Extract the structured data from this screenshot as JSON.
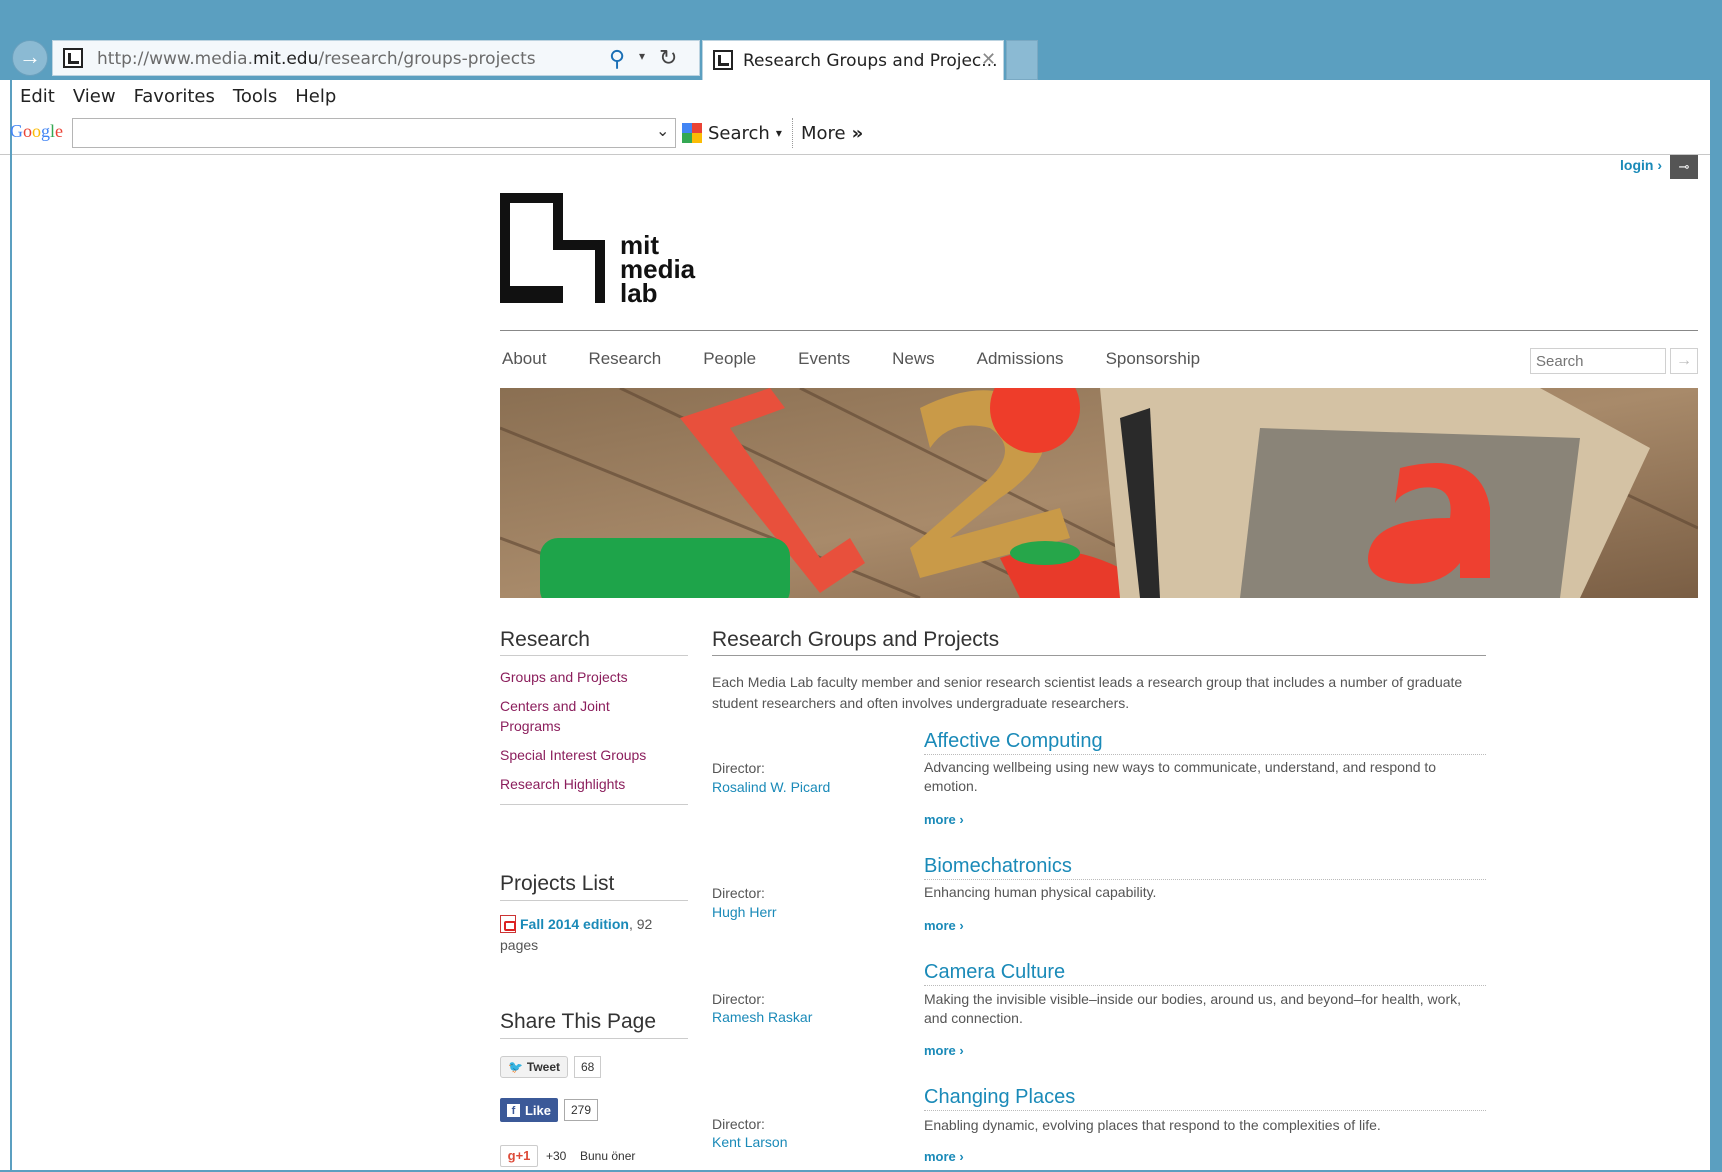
{
  "browser": {
    "url_prefix": "http://www.media.",
    "url_domain": "mit.edu",
    "url_path": "/research/groups-projects",
    "tab_title": "Research Groups and Projec...",
    "menu": [
      "Edit",
      "View",
      "Favorites",
      "Tools",
      "Help"
    ],
    "google_logo": "Google",
    "toolbar_search": "Search",
    "toolbar_more": "More"
  },
  "site": {
    "login": "login ›",
    "logo_lines": [
      "mit",
      "media",
      "lab"
    ],
    "nav": [
      "About",
      "Research",
      "People",
      "Events",
      "News",
      "Admissions",
      "Sponsorship"
    ],
    "search_placeholder": "Search"
  },
  "sidebar": {
    "research_title": "Research",
    "research_links": [
      "Groups and Projects",
      "Centers and Joint Programs",
      "Special Interest Groups",
      "Research Highlights"
    ],
    "projects_title": "Projects List",
    "projects_link": "Fall 2014 edition",
    "projects_suffix": ", 92 pages",
    "share_title": "Share This Page",
    "tweet_label": "Tweet",
    "tweet_count": "68",
    "like_label": "Like",
    "like_count": "279",
    "gplus_label": "+1",
    "gplus_count": "+30",
    "gplus_text": "Bunu öner"
  },
  "main": {
    "title": "Research Groups and Projects",
    "intro": "Each Media Lab faculty member and senior research scientist leads a research group that includes a number of graduate student researchers and often involves undergraduate researchers.",
    "director_label": "Director:",
    "more_label": "more ›",
    "groups": [
      {
        "name": "Affective Computing",
        "director": "Rosalind W. Picard",
        "desc": "Advancing wellbeing using new ways to communicate, understand, and respond to emotion."
      },
      {
        "name": "Biomechatronics",
        "director": "Hugh Herr",
        "desc": "Enhancing human physical capability."
      },
      {
        "name": "Camera Culture",
        "director": "Ramesh Raskar",
        "desc": "Making the invisible visible–inside our bodies, around us, and beyond–for health, work, and connection."
      },
      {
        "name": "Changing Places",
        "director": "Kent Larson",
        "desc": "Enabling dynamic, evolving places that respond to the complexities of life."
      }
    ]
  },
  "colors": {
    "chrome": "#5b9fc0",
    "link_blue": "#1a8ab8",
    "sidebar_link": "#8b1e5c"
  }
}
